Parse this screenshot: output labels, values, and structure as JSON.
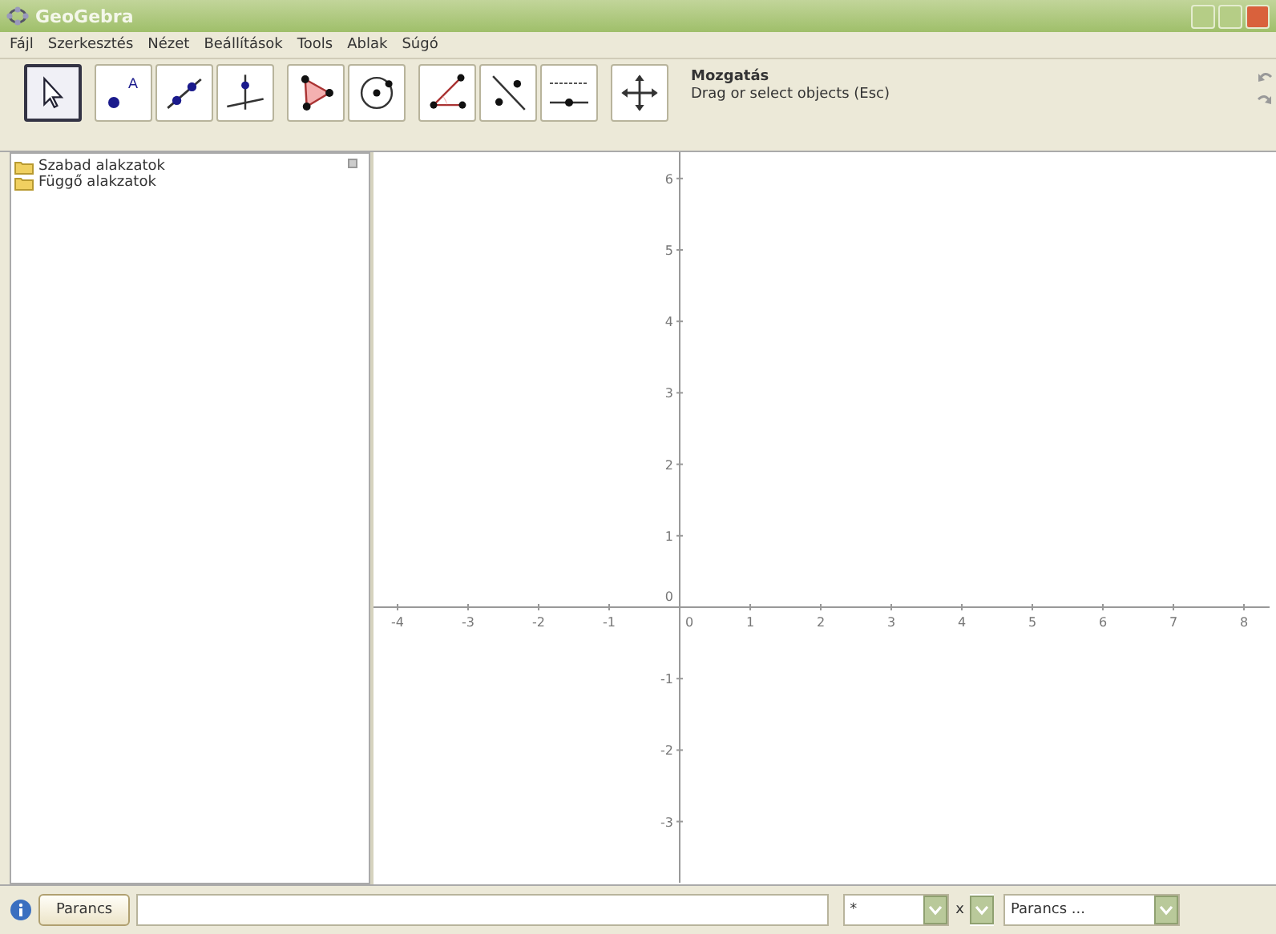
{
  "window": {
    "title": "GeoGebra"
  },
  "menu": [
    "Fájl",
    "Szerkesztés",
    "Nézet",
    "Beállítások",
    "Tools",
    "Ablak",
    "Súgó"
  ],
  "tools": [
    {
      "kind": "move",
      "selected": true
    },
    {
      "kind": "point",
      "selected": false,
      "label": "A"
    },
    {
      "kind": "line",
      "selected": false
    },
    {
      "kind": "perpendicular",
      "selected": false
    },
    {
      "kind": "polygon",
      "selected": false
    },
    {
      "kind": "circle",
      "selected": false
    },
    {
      "kind": "angle",
      "selected": false
    },
    {
      "kind": "reflect",
      "selected": false
    },
    {
      "kind": "slider",
      "selected": false
    },
    {
      "kind": "pan",
      "selected": false
    }
  ],
  "tool_help": {
    "title": "Mozgatás",
    "description": "Drag or select objects (Esc)"
  },
  "sidebar": {
    "items": [
      "Szabad alakzatok",
      "Függő alakzatok"
    ]
  },
  "graphics": {
    "x_labels": [
      "-4",
      "-3",
      "-2",
      "-1",
      "0",
      "1",
      "2",
      "3",
      "4",
      "5",
      "6",
      "7",
      "8"
    ],
    "y_labels": [
      "6",
      "5",
      "4",
      "3",
      "2",
      "1",
      "0",
      "-1",
      "-2",
      "-3"
    ]
  },
  "input_bar": {
    "button": "Parancs",
    "symbol_select": "*",
    "variable_label": "x",
    "command_select": "Parancs ..."
  }
}
